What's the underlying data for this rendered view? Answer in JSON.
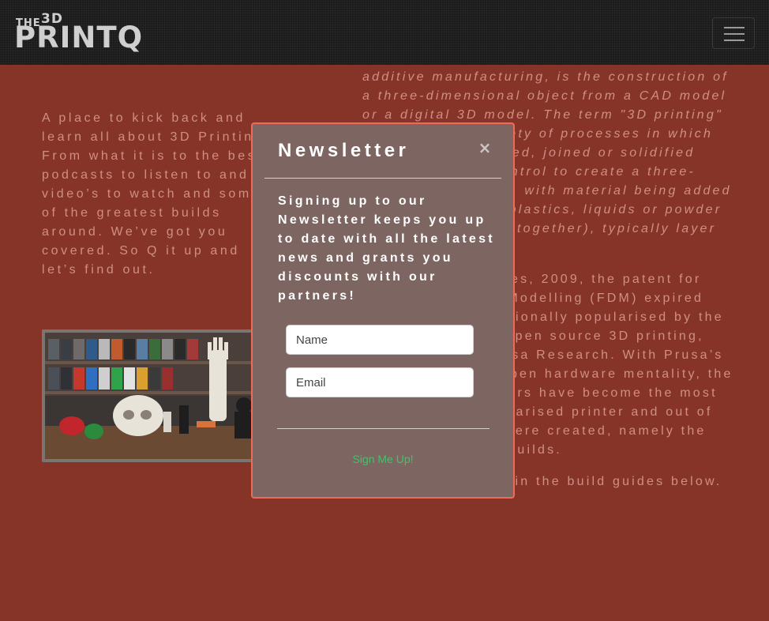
{
  "navbar": {
    "logo_small": "THE",
    "logo_3d": "3D",
    "logo_main": "PRINTQ",
    "menu_button_label": "Toggle navigation"
  },
  "intro": {
    "text": "A place to kick back and learn all about 3D Printing. From what it is to the best podcasts to listen to and video’s to watch and some of the greatest builds around. We’ve got you covered. So Q it up and let’s find out."
  },
  "right_col": {
    "paragraph_1": "additive manufacturing, is the construction of a three-dimensional object from a CAD model or a digital 3D model. The term \"3D printing\" can refer to a variety of processes in which material is deposited, joined or solidified under computer control to create a three-dimensional object, with material being added together (such as plastics, liquids or powder grains being fused together), typically layer by layer.",
    "paragraph_2": "In the late noughties, 2009, the patent for Fused Deposition Modelling (FDM) expired and became sensationally popularised by the now Godfather of open source 3D printing, Josef Prusa of Prusa Research. With Prusa’s open source and open hardware mentality, the i3 MK line of printers have become the most commercially popularised printer and out of it, other flavours were created, namely the Caribou and Bear builds.",
    "paragraph_3": "We’ll explore all 3 in the build guides below."
  },
  "modal": {
    "title": "Newsletter",
    "close_symbol": "×",
    "body": "Signing up to our Newsletter keeps you up to date with all the latest news and grants you discounts with our partners!",
    "name_placeholder": "Name",
    "email_placeholder": "Email",
    "submit_label": "Sign Me Up!"
  },
  "colors": {
    "page_background": "#863428",
    "modal_border": "#f06a57",
    "submit_text": "#3fc46a"
  }
}
